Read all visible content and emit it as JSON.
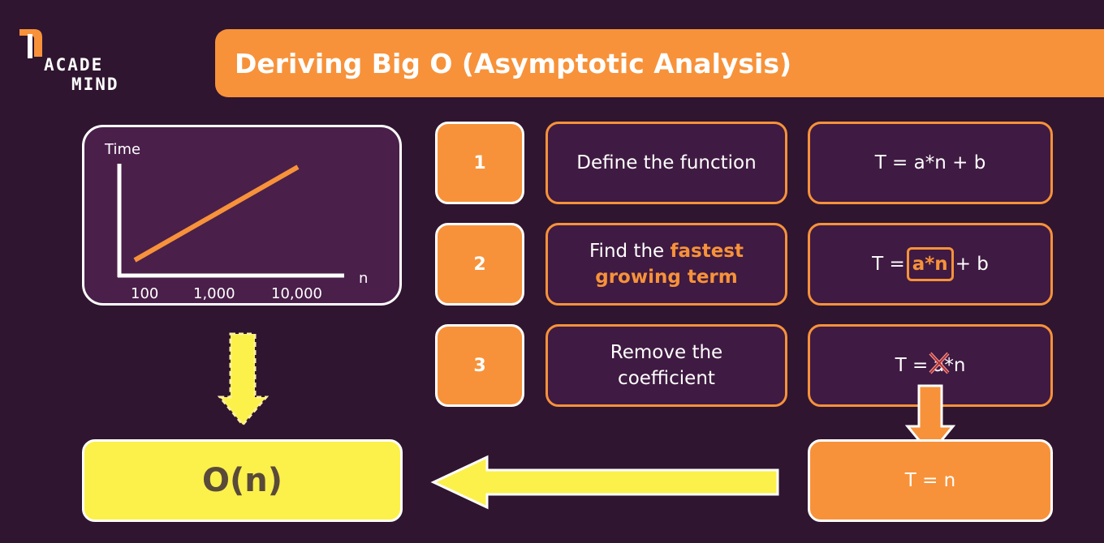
{
  "logo": {
    "line1": "ACADE",
    "line2": "MIND"
  },
  "title": "Deriving Big O (Asymptotic Analysis)",
  "graph": {
    "y_label": "Time",
    "x_label": "n",
    "ticks": [
      "100",
      "1,000",
      "10,000"
    ]
  },
  "steps": [
    {
      "number": "1",
      "text": "Define the function",
      "formula": "T = a*n + b"
    },
    {
      "number": "2",
      "text_before": "Find the",
      "text_highlight_1": "fastest",
      "text_highlight_2": "growing term",
      "formula_left": "T =",
      "formula_term": "a*n",
      "formula_right": "+ b"
    },
    {
      "number": "3",
      "text_line1": "Remove the",
      "text_line2": "coefficient",
      "formula_left": "T =",
      "formula_struck": "a",
      "formula_right": "*n"
    }
  ],
  "result": "T = n",
  "big_o": "O(n)",
  "colors": {
    "accent": "#f7923a",
    "background": "#2f1530",
    "yellow": "#fbf14a",
    "panel": "#4a1f4a"
  }
}
